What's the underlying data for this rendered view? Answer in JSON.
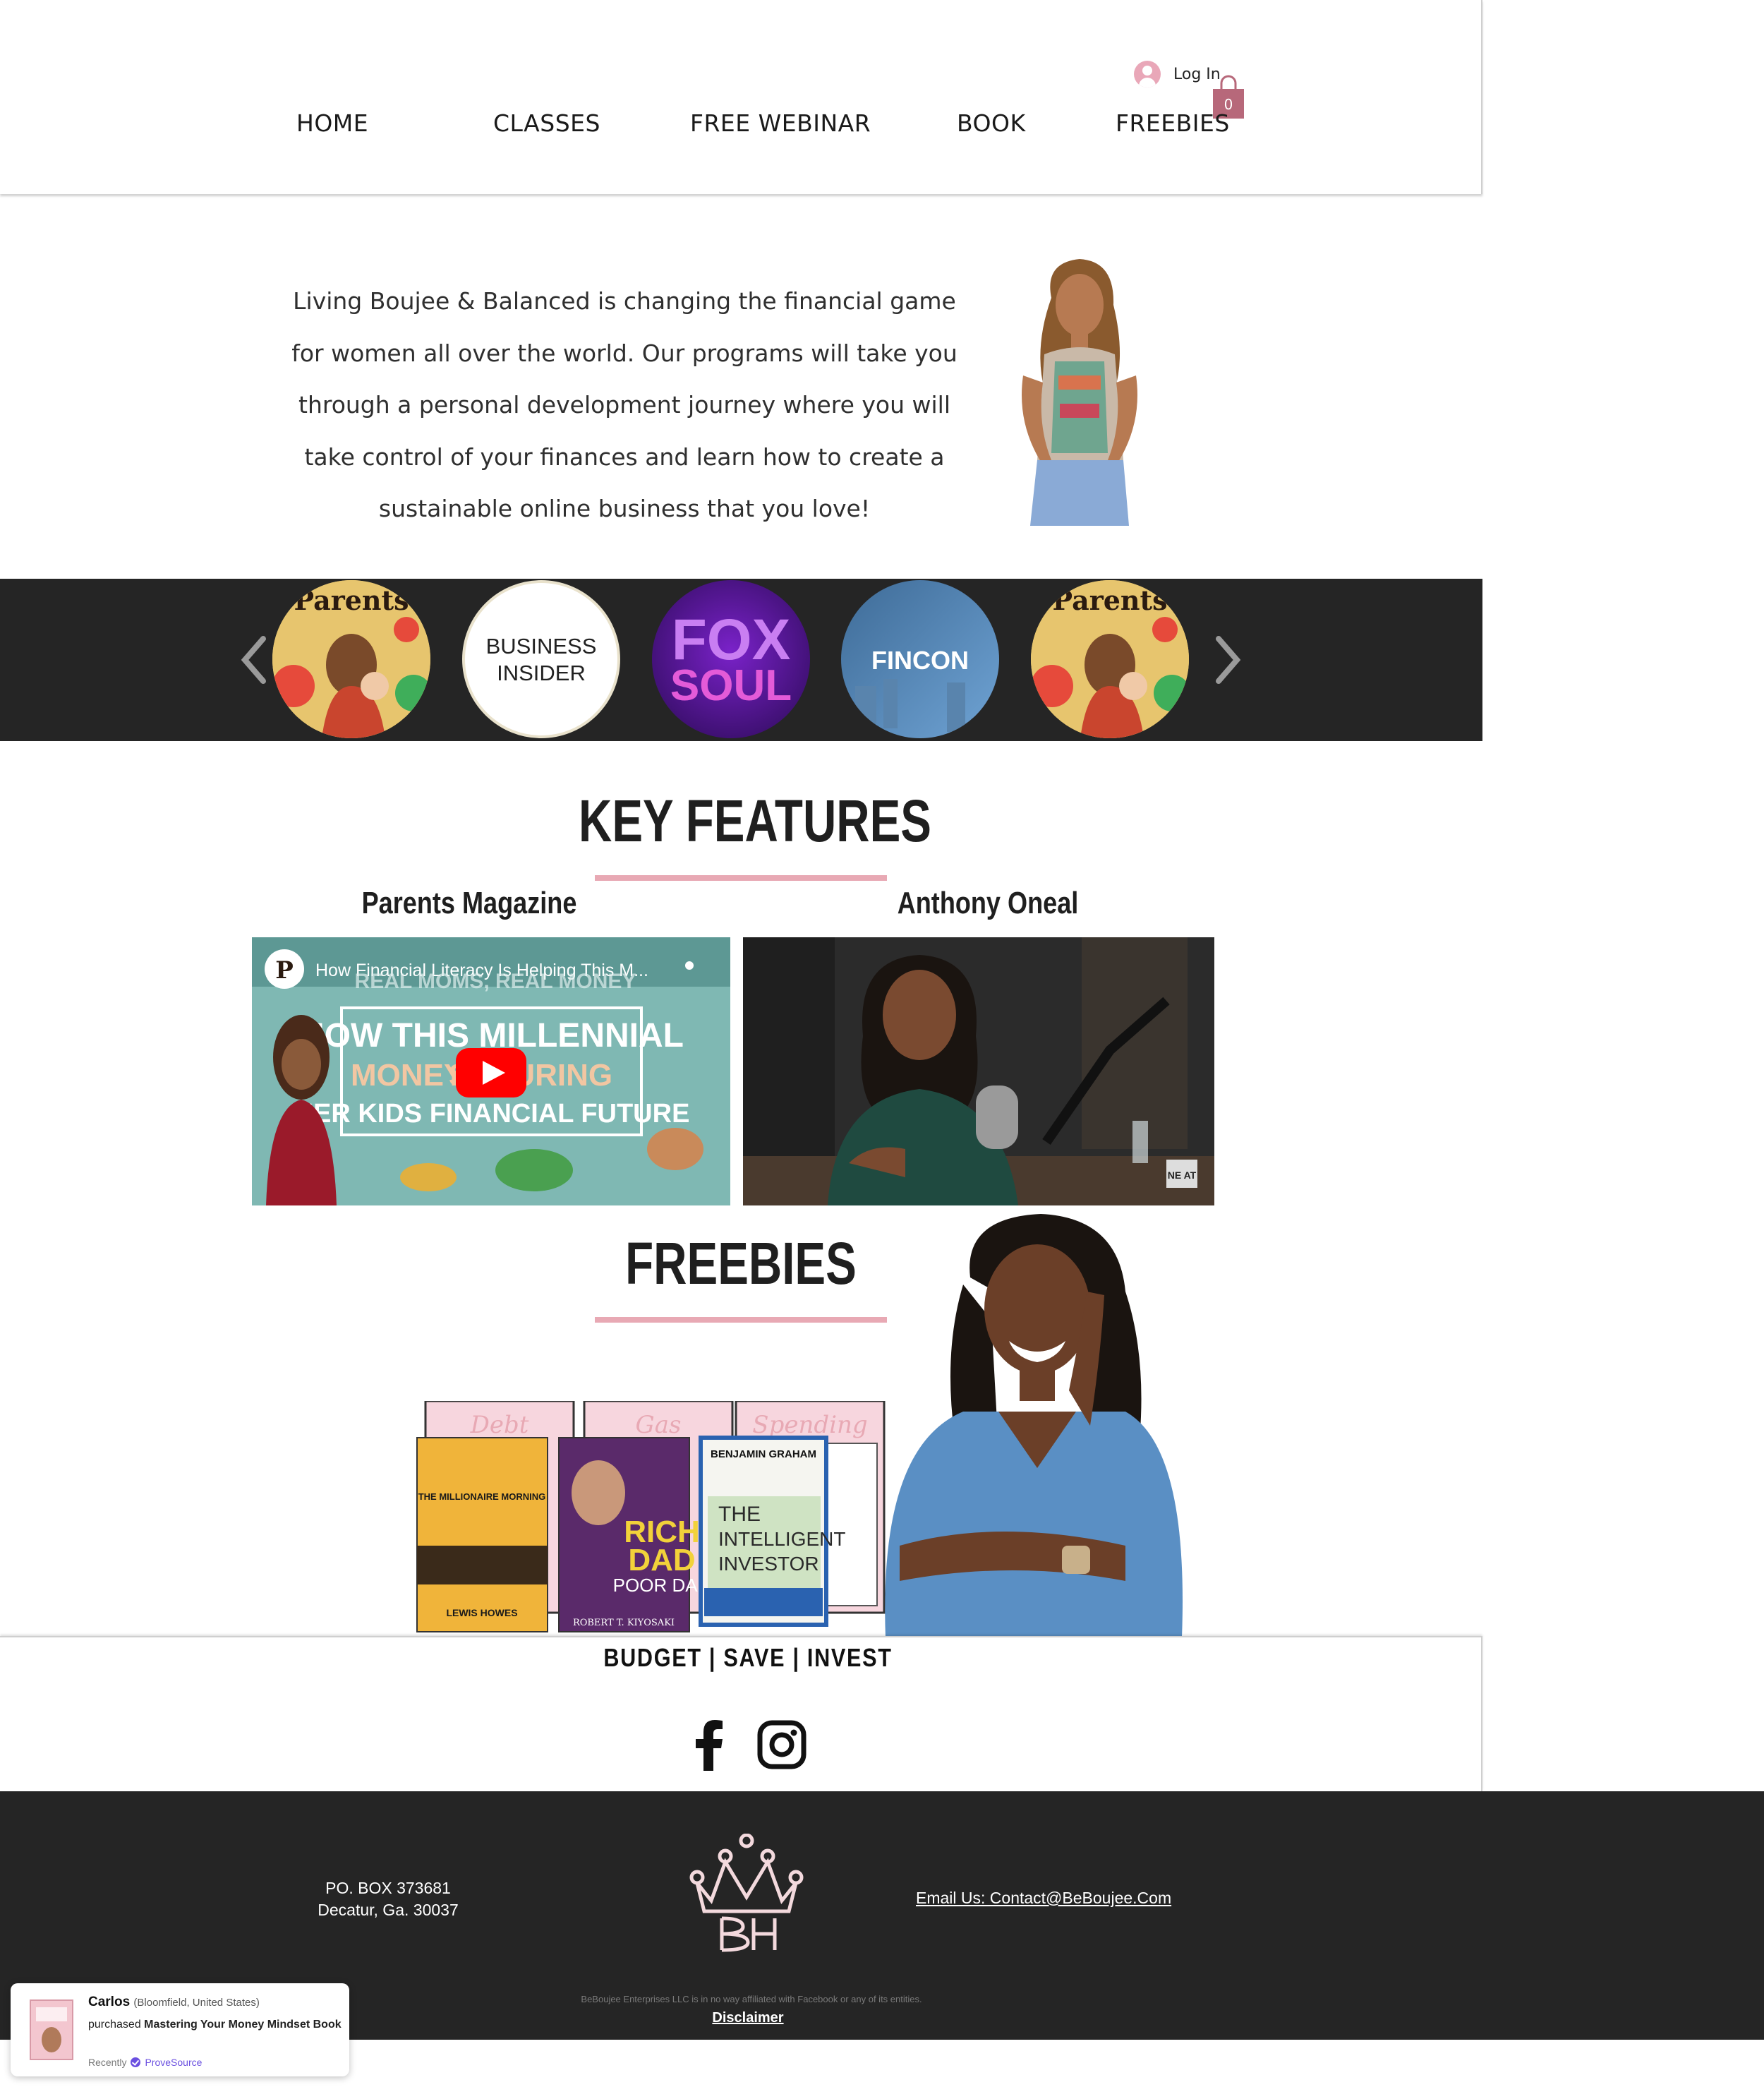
{
  "header": {
    "nav": [
      {
        "label": "HOME"
      },
      {
        "label": "CLASSES"
      },
      {
        "label": "FREE WEBINAR"
      },
      {
        "label": "BOOK"
      },
      {
        "label": "FREEBIES"
      }
    ],
    "login_label": "Log In",
    "cart_count": "0"
  },
  "intro": {
    "text": "Living Boujee & Balanced is changing the financial game for women all over the world. Our programs will take you through a personal development journey where you will take control of your finances and learn how to create a sustainable online business that you love!"
  },
  "carousel": {
    "logos": [
      {
        "name": "Parents",
        "icon": "parents-magazine-cover"
      },
      {
        "name": "BUSINESS INSIDER",
        "line1": "BUSINESS",
        "line2": "INSIDER"
      },
      {
        "name": "FOX SOUL",
        "line1": "FOX",
        "line2": "SOUL"
      },
      {
        "name": "FINCON"
      },
      {
        "name": "Parents",
        "icon": "parents-magazine-cover"
      }
    ],
    "colors": {
      "bg": "#252525",
      "fox": "#6b1fb8",
      "fincon": "#4a7fb2"
    }
  },
  "key_features": {
    "title": "KEY FEATURES",
    "videos": [
      {
        "label": "Parents Magazine",
        "title": "How Financial Literacy Is Helping This M...",
        "thumb_lines": [
          "REAL MOMS, REAL MONEY",
          "HOW THIS MILLENNIAL",
          "MONEY M",
          "SECURING",
          "HER KIDS FINANCIAL FUTURE"
        ]
      },
      {
        "label": "Anthony Oneal",
        "badge": "NE AT"
      }
    ]
  },
  "freebies": {
    "title": "FREEBIES",
    "books": [
      {
        "title": "THE MILLIONAIRE MORNING",
        "author": "LEWIS HOWES"
      },
      {
        "title": "RICH DAD POOR DAD",
        "author": "ROBERT T. KIYOSAKI"
      },
      {
        "title": "THE INTELLIGENT INVESTOR",
        "author": "BENJAMIN GRAHAM"
      }
    ],
    "worksheets": [
      "Debt",
      "Gas",
      "Spending"
    ]
  },
  "strip": {
    "tagline": "BUDGET | SAVE | INVEST"
  },
  "footer": {
    "address_line1": "PO. BOX 373681",
    "address_line2": "Decatur, Ga. 30037",
    "email": "Email Us: Contact@BeBoujee.Com",
    "note": "BeBoujee Enterprises LLC is in no way affiliated with Facebook or any of its entities.",
    "disclaimer": "Disclaimer"
  },
  "notification": {
    "name": "Carlos",
    "location": "(Bloomfield, United States)",
    "action": "purchased",
    "product": "Mastering Your Money Mindset Book",
    "when": "Recently",
    "brand": "ProveSource"
  },
  "colors": {
    "accent_pink": "#e8a9b4",
    "dark": "#252525",
    "cart": "#b7687a"
  }
}
